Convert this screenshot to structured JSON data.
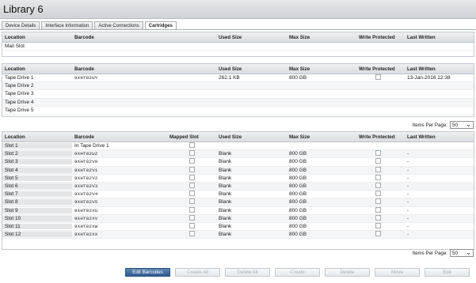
{
  "window": {
    "title": "Library 6"
  },
  "tabs": [
    {
      "label": "Device Details",
      "active": false
    },
    {
      "label": "Interface Information",
      "active": false
    },
    {
      "label": "Active Connections",
      "active": false
    },
    {
      "label": "Cartridges",
      "active": true
    }
  ],
  "mailslot_table": {
    "headers": {
      "location": "Location",
      "barcode": "Barcode",
      "used_size": "Used Size",
      "max_size": "Max Size",
      "write_protected": "Write Protected",
      "last_written": "Last Written"
    },
    "rows": [
      {
        "location": "Mail Slot",
        "barcode": "",
        "used_size": "",
        "max_size": "",
        "last_written": ""
      }
    ]
  },
  "drive_table": {
    "headers": {
      "location": "Location",
      "barcode": "Barcode",
      "used_size": "Used Size",
      "max_size": "Max Size",
      "write_protected": "Write Protected",
      "last_written": "Last Written"
    },
    "rows": [
      {
        "location": "Tape Drive 1",
        "barcode": "9XHT82UY",
        "used_size": "262.1 KB",
        "max_size": "800 GB",
        "last_written": "13-Jan-2016 12:38",
        "has_checkbox": true
      },
      {
        "location": "Tape Drive 2",
        "barcode": "",
        "used_size": "",
        "max_size": "",
        "last_written": "",
        "has_checkbox": false
      },
      {
        "location": "Tape Drive 3",
        "barcode": "",
        "used_size": "",
        "max_size": "",
        "last_written": "",
        "has_checkbox": false
      },
      {
        "location": "Tape Drive 4",
        "barcode": "",
        "used_size": "",
        "max_size": "",
        "last_written": "",
        "has_checkbox": false
      },
      {
        "location": "Tape Drive 5",
        "barcode": "",
        "used_size": "",
        "max_size": "",
        "last_written": "",
        "has_checkbox": false
      }
    ]
  },
  "pager_top": {
    "label": "Items Per Page:",
    "value": "50"
  },
  "slot_table": {
    "headers": {
      "location": "Location",
      "barcode": "Barcode",
      "mapped_slot": "Mapped Slot",
      "used_size": "Used Size",
      "max_size": "Max Size",
      "write_protected": "Write Protected",
      "last_written": "Last Written"
    },
    "rows": [
      {
        "location": "Slot 1",
        "barcode": "In Tape Drive 1",
        "used_size": "",
        "max_size": "",
        "last_written": "",
        "wp": false
      },
      {
        "location": "Slot 2",
        "barcode": "9XHT82UZ",
        "used_size": "Blank",
        "max_size": "800 GB",
        "last_written": "-",
        "wp": true
      },
      {
        "location": "Slot 3",
        "barcode": "9XHT82V0",
        "used_size": "Blank",
        "max_size": "800 GB",
        "last_written": "-",
        "wp": true
      },
      {
        "location": "Slot 4",
        "barcode": "9XHT82V1",
        "used_size": "Blank",
        "max_size": "800 GB",
        "last_written": "-",
        "wp": true
      },
      {
        "location": "Slot 5",
        "barcode": "9XHT82V2",
        "used_size": "Blank",
        "max_size": "800 GB",
        "last_written": "-",
        "wp": true
      },
      {
        "location": "Slot 6",
        "barcode": "9XHT82V3",
        "used_size": "Blank",
        "max_size": "800 GB",
        "last_written": "-",
        "wp": true
      },
      {
        "location": "Slot 7",
        "barcode": "9XHT82V4",
        "used_size": "Blank",
        "max_size": "800 GB",
        "last_written": "-",
        "wp": true
      },
      {
        "location": "Slot 8",
        "barcode": "9XHT82V5",
        "used_size": "Blank",
        "max_size": "800 GB",
        "last_written": "-",
        "wp": true
      },
      {
        "location": "Slot 9",
        "barcode": "9XHT82XU",
        "used_size": "Blank",
        "max_size": "800 GB",
        "last_written": "-",
        "wp": true
      },
      {
        "location": "Slot 10",
        "barcode": "9XHT82XV",
        "used_size": "Blank",
        "max_size": "800 GB",
        "last_written": "-",
        "wp": true
      },
      {
        "location": "Slot 11",
        "barcode": "9XHT82XW",
        "used_size": "Blank",
        "max_size": "800 GB",
        "last_written": "-",
        "wp": true
      },
      {
        "location": "Slot 12",
        "barcode": "9XHT82XX",
        "used_size": "Blank",
        "max_size": "800 GB",
        "last_written": "-",
        "wp": true
      }
    ]
  },
  "pager_bottom": {
    "label": "Items Per Page:",
    "value": "50"
  },
  "buttons": {
    "edit_barcodes": "Edit Barcodes",
    "create_all": "Create All",
    "delete_all": "Delete All",
    "create": "Create",
    "delete": "Delete",
    "move": "Move",
    "edit": "Edit"
  },
  "colors": {
    "primary_button": "#2f5b8f",
    "header_gradient": "#d9dde1"
  }
}
